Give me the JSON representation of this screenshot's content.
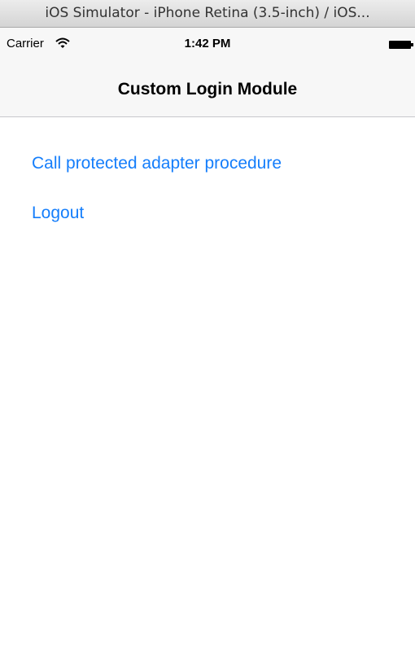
{
  "window": {
    "title": "iOS Simulator - iPhone Retina (3.5-inch) / iOS..."
  },
  "status_bar": {
    "carrier": "Carrier",
    "wifi_icon": "wifi-icon",
    "time": "1:42 PM",
    "battery_icon": "battery-icon"
  },
  "nav_bar": {
    "title": "Custom Login Module"
  },
  "main": {
    "buttons": [
      {
        "label": "Call protected adapter procedure"
      },
      {
        "label": "Logout"
      }
    ]
  },
  "colors": {
    "link": "#157efb",
    "nav_background": "#f7f7f7",
    "separator": "#c8c7cc"
  }
}
